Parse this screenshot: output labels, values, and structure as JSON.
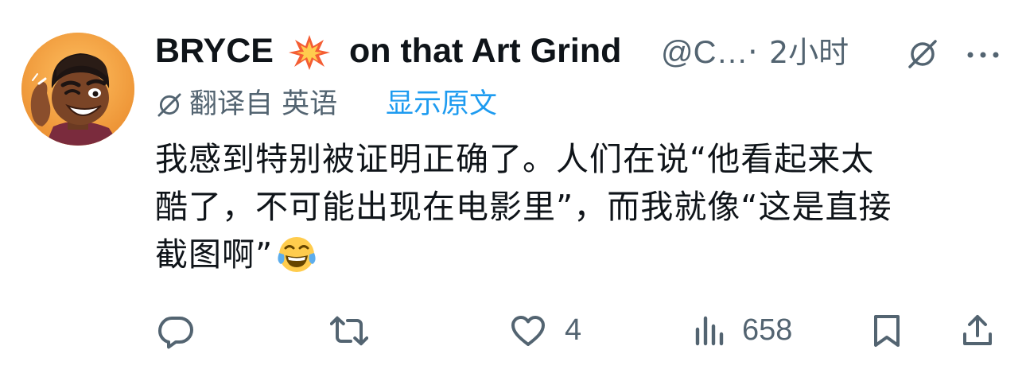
{
  "author": {
    "display_name_part1": "BRYCE",
    "display_name_emoji": "collision-emoji-icon",
    "display_name_part2": "on that Art Grind",
    "handle": "@C…",
    "separator": "·",
    "time": "2小时"
  },
  "translation": {
    "translated_from": "翻译自 英语",
    "show_original": "显示原文"
  },
  "tweet": {
    "lines": [
      "我感到特别被证明正确了。人们在说“他看起来太",
      "酷了，不可能出现在电影里”，而我就像“这是直接",
      "截图啊”"
    ],
    "trailing_emoji": "face-with-tears-of-joy-icon"
  },
  "actions": {
    "reply_icon": "reply-icon",
    "retweet_icon": "retweet-icon",
    "like_icon": "heart-icon",
    "like_count": "4",
    "views_icon": "views-icon",
    "views_count": "658",
    "bookmark_icon": "bookmark-icon",
    "share_icon": "share-icon"
  },
  "colors": {
    "text_primary": "#0f1419",
    "text_secondary": "#536471",
    "link": "#1d9bf0"
  }
}
